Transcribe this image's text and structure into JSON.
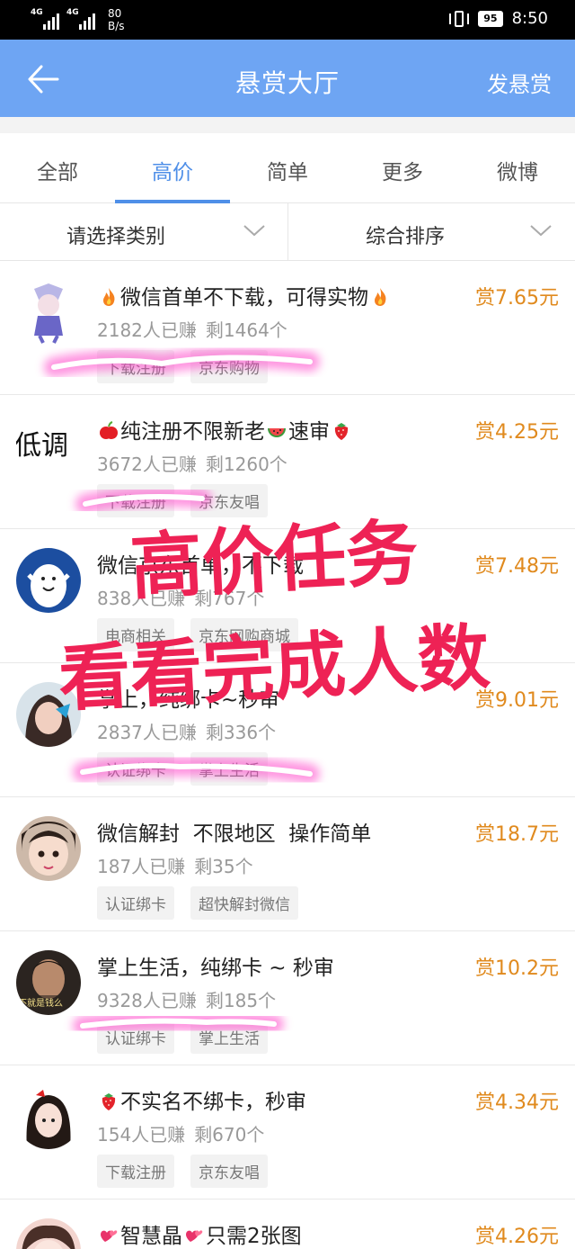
{
  "status_bar": {
    "net1": "4G",
    "net2": "4G",
    "speed_value": "80",
    "speed_unit": "B/s",
    "battery": "95",
    "time": "8:50"
  },
  "header": {
    "title": "悬赏大厅",
    "action": "发悬赏"
  },
  "tabs": [
    {
      "label": "全部"
    },
    {
      "label": "高价",
      "active": true
    },
    {
      "label": "简单"
    },
    {
      "label": "更多"
    },
    {
      "label": "微博"
    }
  ],
  "filters": {
    "category": "请选择类别",
    "sort": "综合排序"
  },
  "tasks": [
    {
      "title": "微信首单不下载，可得实物",
      "earned": "2182人已赚",
      "remaining": "剩1464个",
      "reward": "赏7.65元",
      "tags": [
        "下载注册",
        "京东购物"
      ]
    },
    {
      "title": "纯注册不限新老",
      "title_tail": "速审",
      "avatar_text": "低调",
      "earned": "3672人已赚",
      "remaining": "剩1260个",
      "reward": "赏4.25元",
      "tags": [
        "下载注册",
        "京东友唱"
      ]
    },
    {
      "title": "微信京东首单，不下载",
      "earned": "838人已赚",
      "remaining": "剩767个",
      "reward": "赏7.48元",
      "tags": [
        "电商相关",
        "京东网购商城"
      ]
    },
    {
      "title": "掌上，纯绑卡~秒审",
      "earned": "2837人已赚",
      "remaining": "剩336个",
      "reward": "赏9.01元",
      "tags": [
        "认证绑卡",
        "掌上生活"
      ]
    },
    {
      "title": "微信解封  不限地区  操作简单",
      "earned": "187人已赚",
      "remaining": "剩35个",
      "reward": "赏18.7元",
      "tags": [
        "认证绑卡",
        "超快解封微信"
      ]
    },
    {
      "title": "掌上生活，纯绑卡 ~ 秒审",
      "avatar_text": "不就是钱么",
      "earned": "9328人已赚",
      "remaining": "剩185个",
      "reward": "赏10.2元",
      "tags": [
        "认证绑卡",
        "掌上生活"
      ]
    },
    {
      "title": "不实名不绑卡，秒审",
      "earned": "154人已赚",
      "remaining": "剩670个",
      "reward": "赏4.34元",
      "tags": [
        "下载注册",
        "京东友唱"
      ]
    },
    {
      "title": "智慧晶",
      "title_tail": "只需2张图",
      "earned": "",
      "remaining": "",
      "reward": "赏4.26元",
      "tags": []
    }
  ],
  "overlay": {
    "line1": "高价任务",
    "line2": "看看完成人数"
  },
  "colors": {
    "header_bg": "#6ea5f3",
    "accent": "#4f8fe8",
    "reward": "#e08a1e",
    "overlay_text": "#ee2255",
    "highlighter": "#ff3fc8"
  }
}
